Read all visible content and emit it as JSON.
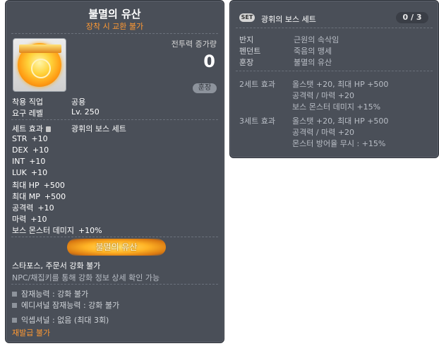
{
  "item": {
    "name": "불멸의 유산",
    "trade_note": "장착 시 교환 불가",
    "combat_power_label": "전투력 증가량",
    "combat_power_value": "0",
    "category_button": "훈장",
    "job_label": "착용 직업",
    "job_value": "공용",
    "level_label": "요구 레벨",
    "level_value": "Lv. 250",
    "set_effect_label": "세트 효과",
    "set_effect_name": "광휘의 보스 세트",
    "stats": [
      {
        "name": "STR",
        "value": "+10"
      },
      {
        "name": "DEX",
        "value": "+10"
      },
      {
        "name": "INT",
        "value": "+10"
      },
      {
        "name": "LUK",
        "value": "+10"
      },
      {
        "name": "최대 HP",
        "value": "+500"
      },
      {
        "name": "최대 MP",
        "value": "+500"
      },
      {
        "name": "공격력",
        "value": "+10"
      },
      {
        "name": "마력",
        "value": "+10"
      },
      {
        "name": "보스 몬스터 데미지",
        "value": "+10%"
      }
    ],
    "badge_text": "불멸의 유산",
    "enhance_title": "스타포스, 주문서 강화 불가",
    "enhance_desc": "NPC/채집키를 통해 강화 정보 상세 확인 가능",
    "potentials": [
      "잠재능력 : 강화 불가",
      "에디셔널 잠재능력 : 강화 불가",
      "익셉셔널 : 없음 (최대 3회)"
    ],
    "reissue_note": "재발급 불가"
  },
  "set": {
    "tag": "SET",
    "title": "광휘의 보스 세트",
    "count": "0 / 3",
    "items": [
      {
        "slot": "반지",
        "name": "근원의 속삭임"
      },
      {
        "slot": "펜던트",
        "name": "죽음의 맹세"
      },
      {
        "slot": "훈장",
        "name": "불멸의 유산"
      }
    ],
    "effects": [
      {
        "label": "2세트 효과",
        "lines": [
          "올스탯 +20, 최대 HP  +500",
          "공격력 / 마력  +20",
          "보스 몬스터 데미지 +15%"
        ]
      },
      {
        "label": "3세트 효과",
        "lines": [
          "올스탯 +20, 최대 HP  +500",
          "공격력 / 마력  +20",
          "몬스터 방어율 무시 : +15%"
        ]
      }
    ]
  },
  "colors": {
    "panel_bg": "#4a4f58",
    "accent_orange": "#ff9933",
    "text_primary": "#ffffff",
    "text_secondary": "#b9bec6"
  }
}
